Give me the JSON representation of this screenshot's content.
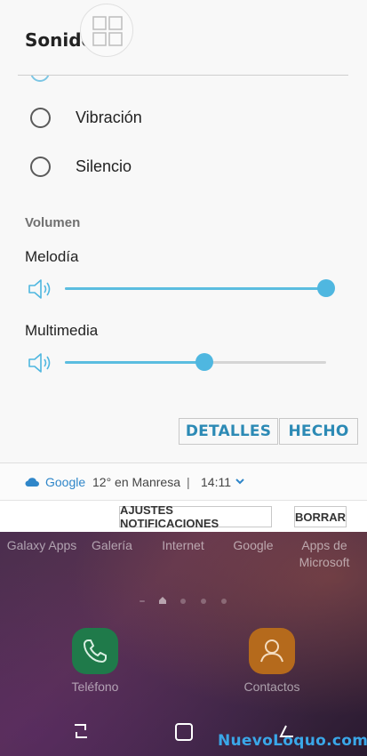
{
  "panel": {
    "title": "Sonido",
    "options": [
      {
        "label": "Vibración"
      },
      {
        "label": "Silencio"
      }
    ],
    "volume_section_title": "Volumen",
    "sliders": [
      {
        "label": "Melodía",
        "level": 1.0
      },
      {
        "label": "Multimedia",
        "level": 0.535
      }
    ],
    "buttons": {
      "details": "DETALLES",
      "done": "HECHO"
    }
  },
  "notification": {
    "app": "Google",
    "weather": "12° en Manresa",
    "separator": "|",
    "time": "14:11"
  },
  "notification_actions": {
    "settings": "AJUSTES NOTIFICACIONES",
    "clear": "BORRAR"
  },
  "home": {
    "apps": [
      {
        "label": "Galaxy Apps"
      },
      {
        "label": "Galería"
      },
      {
        "label": "Internet"
      },
      {
        "label": "Google"
      },
      {
        "label": "Apps de Microsoft"
      }
    ],
    "dock": [
      {
        "label": "Teléfono"
      },
      {
        "label": "Contactos"
      }
    ]
  },
  "watermark": "NuevoLoquo.com",
  "colors": {
    "accent": "#4fb7e0",
    "button_text": "#2c8ab5",
    "watermark": "#3aa7e8"
  }
}
